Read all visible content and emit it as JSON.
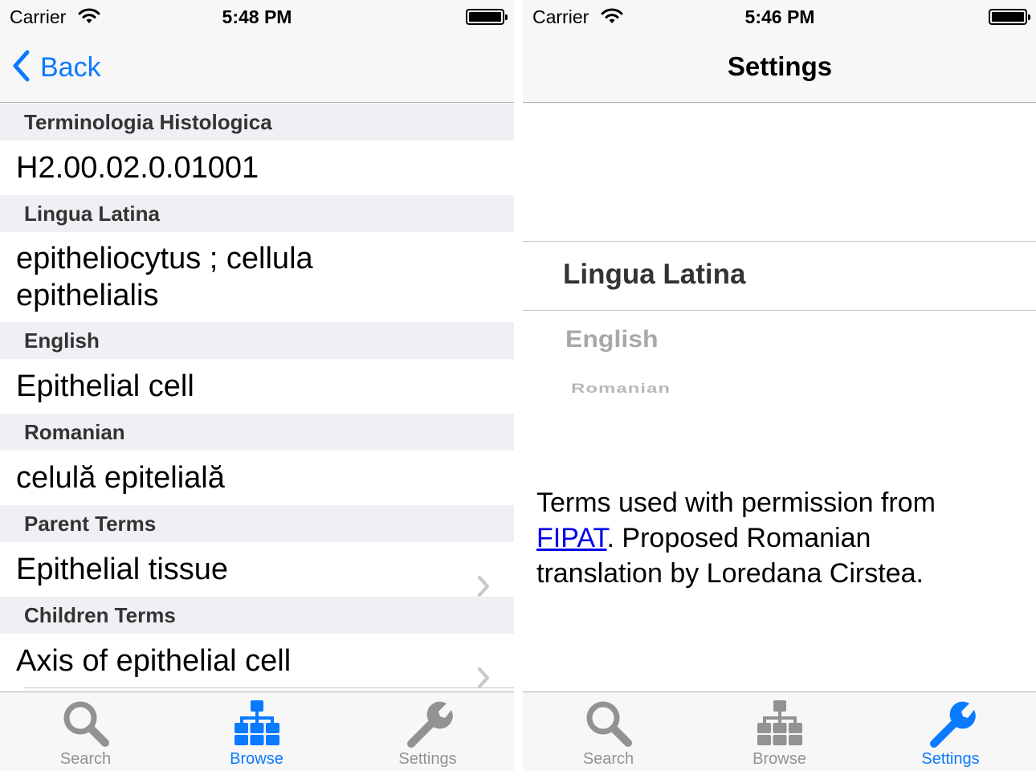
{
  "left_screen": {
    "status": {
      "carrier": "Carrier",
      "time": "5:48 PM"
    },
    "nav": {
      "back_label": "Back"
    },
    "sections": [
      {
        "header": "Terminologia Histologica",
        "value": "H2.00.02.0.01001"
      },
      {
        "header": "Lingua Latina",
        "value": "epitheliocytus  ;  cellula epithelialis"
      },
      {
        "header": "English",
        "value": "Epithelial cell"
      },
      {
        "header": "Romanian",
        "value": "celulă epitelială"
      },
      {
        "header": "Parent Terms",
        "value": "Epithelial tissue"
      },
      {
        "header": "Children Terms",
        "value": "Axis of epithelial cell"
      }
    ],
    "tabbar": {
      "tabs": [
        {
          "label": "Search",
          "icon": "search-icon"
        },
        {
          "label": "Browse",
          "icon": "browse-hierarchy-icon"
        },
        {
          "label": "Settings",
          "icon": "wrench-icon"
        }
      ],
      "selected": "Browse"
    }
  },
  "right_screen": {
    "status": {
      "carrier": "Carrier",
      "time": "5:46 PM"
    },
    "nav": {
      "title": "Settings"
    },
    "language_picker": {
      "options": [
        "Lingua Latina",
        "English",
        "Romanian"
      ],
      "selected": "Lingua Latina"
    },
    "credits": {
      "text_before": "Terms used with permission from ",
      "link": "FIPAT",
      "text_after": ". Proposed Romanian translation by Loredana Cirstea."
    },
    "tabbar": {
      "tabs": [
        {
          "label": "Search",
          "icon": "search-icon"
        },
        {
          "label": "Browse",
          "icon": "browse-hierarchy-icon"
        },
        {
          "label": "Settings",
          "icon": "wrench-icon"
        }
      ],
      "selected": "Settings"
    }
  },
  "colors": {
    "accent": "#0a7aff",
    "inactive": "#929292",
    "section_bg": "#efeff4",
    "bar_bg": "#f7f7f7",
    "link": "#0000ee"
  }
}
